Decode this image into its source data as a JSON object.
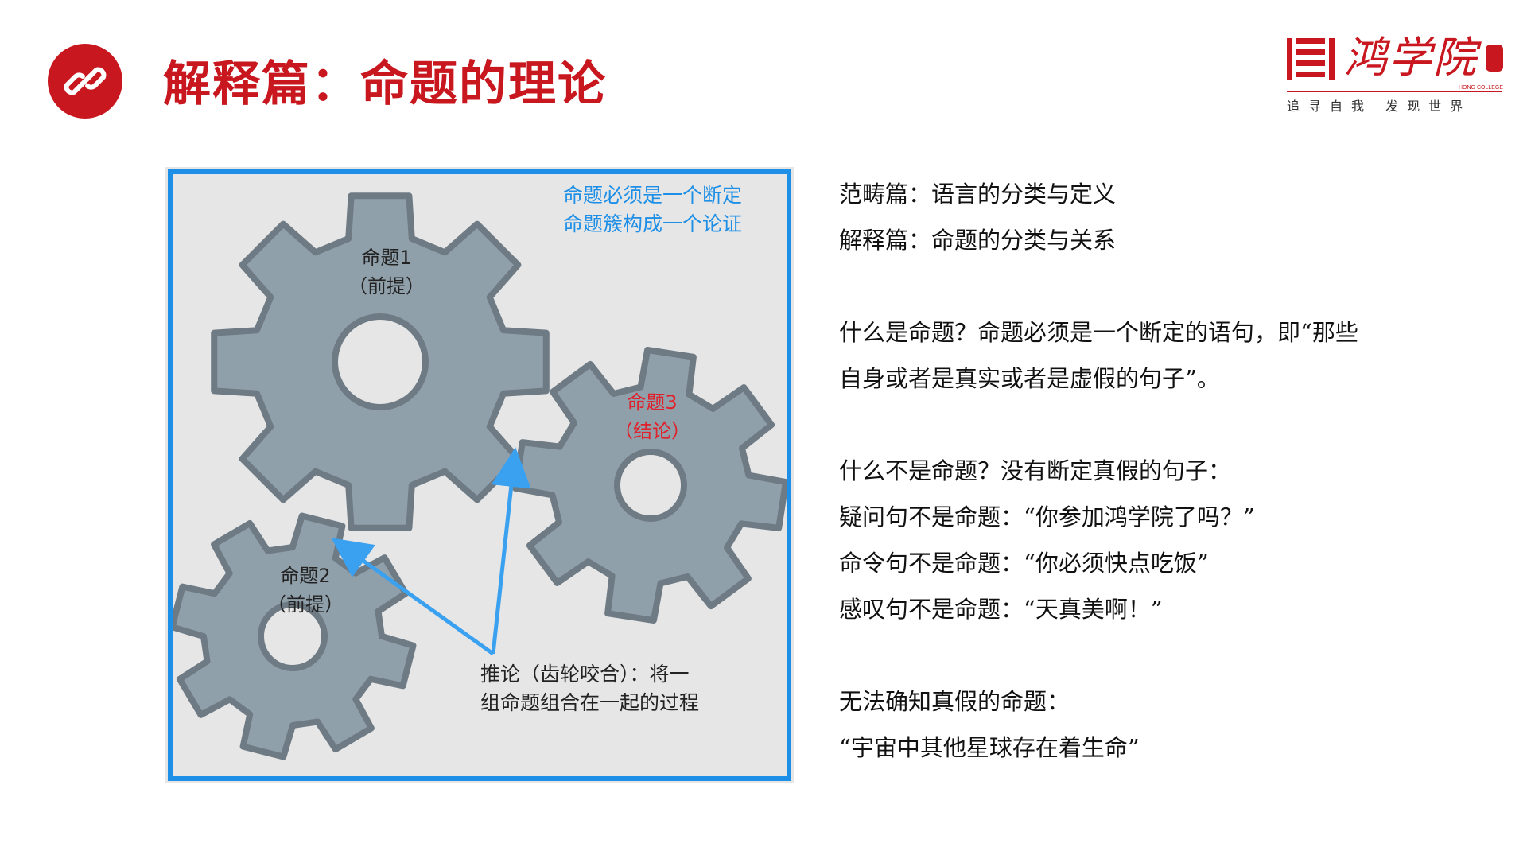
{
  "header": {
    "title": "解释篇：命题的理论",
    "icon": "link-icon",
    "accent_color": "#c8171e"
  },
  "logo": {
    "name": "鸿学院",
    "english": "HONG COLLEGE",
    "slogan": "追寻自我 发现世界"
  },
  "diagram": {
    "note_lines": [
      "命题必须是一个断定",
      "命题簇构成一个论证"
    ],
    "gears": [
      {
        "title": "命题1",
        "subtitle": "（前提）"
      },
      {
        "title": "命题2",
        "subtitle": "（前提）"
      },
      {
        "title": "命题3",
        "subtitle": "（结论）"
      }
    ],
    "inference_lines": [
      "推论（齿轮咬合）：将一",
      "组命题组合在一起的过程"
    ],
    "colors": {
      "gear": "#90a0ab",
      "gear_outline": "#6f7b84",
      "arrow": "#3aa0f0",
      "frame": "#1e8fe6",
      "conclusion": "#e0202a"
    }
  },
  "content": {
    "scope_lines": [
      "范畴篇：语言的分类与定义",
      "解释篇：命题的分类与关系"
    ],
    "what_is_lines": [
      "什么是命题？命题必须是一个断定的语句，即“那些",
      "自身或者是真实或者是虚假的句子”。"
    ],
    "what_is_not_lines": [
      "什么不是命题？没有断定真假的句子：",
      "疑问句不是命题：“你参加鸿学院了吗？”",
      "命令句不是命题：“你必须快点吃饭”",
      "感叹句不是命题：“天真美啊！”"
    ],
    "unknown_lines": [
      "无法确知真假的命题：",
      "“宇宙中其他星球存在着生命”"
    ]
  }
}
